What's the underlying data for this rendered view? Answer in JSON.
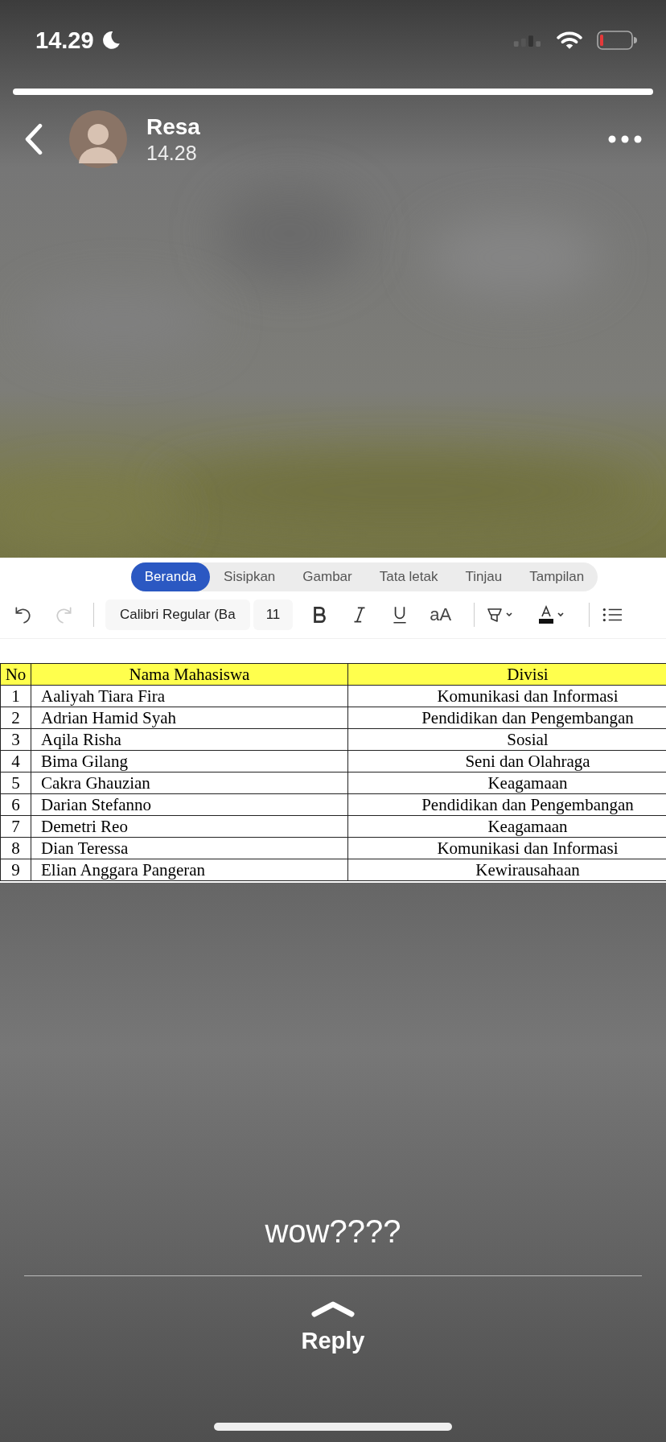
{
  "status_bar": {
    "time": "14.29"
  },
  "story": {
    "progress": {
      "level": 1
    },
    "user": "Resa",
    "posted": "14.28"
  },
  "document": {
    "tabs": [
      {
        "label": "Beranda",
        "selected": true
      },
      {
        "label": "Sisipkan",
        "selected": false
      },
      {
        "label": "Gambar",
        "selected": false
      },
      {
        "label": "Tata letak",
        "selected": false
      },
      {
        "label": "Tinjau",
        "selected": false
      },
      {
        "label": "Tampilan",
        "selected": false
      }
    ],
    "toolbar": [
      {
        "kind": "undo",
        "disabled": false
      },
      {
        "kind": "redo",
        "disabled": true
      },
      {
        "kind": "font",
        "value": "Calibri Regular (Ba"
      },
      {
        "kind": "size",
        "value": "11"
      },
      {
        "kind": "bold"
      },
      {
        "kind": "italic"
      },
      {
        "kind": "underline"
      },
      {
        "kind": "case",
        "label": "aA"
      },
      {
        "kind": "highlight"
      },
      {
        "kind": "color"
      },
      {
        "kind": "list"
      }
    ],
    "table": {
      "columns": [
        "No",
        "Nama Mahasiswa",
        "Divisi"
      ],
      "rows": [
        [
          "1",
          "Aaliyah Tiara Fira",
          "Komunikasi dan Informasi"
        ],
        [
          "2",
          "Adrian Hamid Syah",
          "Pendidikan dan Pengembangan"
        ],
        [
          "3",
          "Aqila Risha",
          "Sosial"
        ],
        [
          "4",
          "Bima Gilang",
          "Seni dan Olahraga"
        ],
        [
          "5",
          "Cakra Ghauzian",
          "Keagamaan"
        ],
        [
          "6",
          "Darian Stefanno",
          "Pendidikan dan Pengembangan"
        ],
        [
          "7",
          "Demetri Reo",
          "Keagamaan"
        ],
        [
          "8",
          "Dian Teressa",
          "Komunikasi dan Informasi"
        ],
        [
          "9",
          "Elian Anggara Pangeran",
          "Kewirausahaan"
        ]
      ]
    }
  },
  "caption": "wow????",
  "reply": "Reply"
}
